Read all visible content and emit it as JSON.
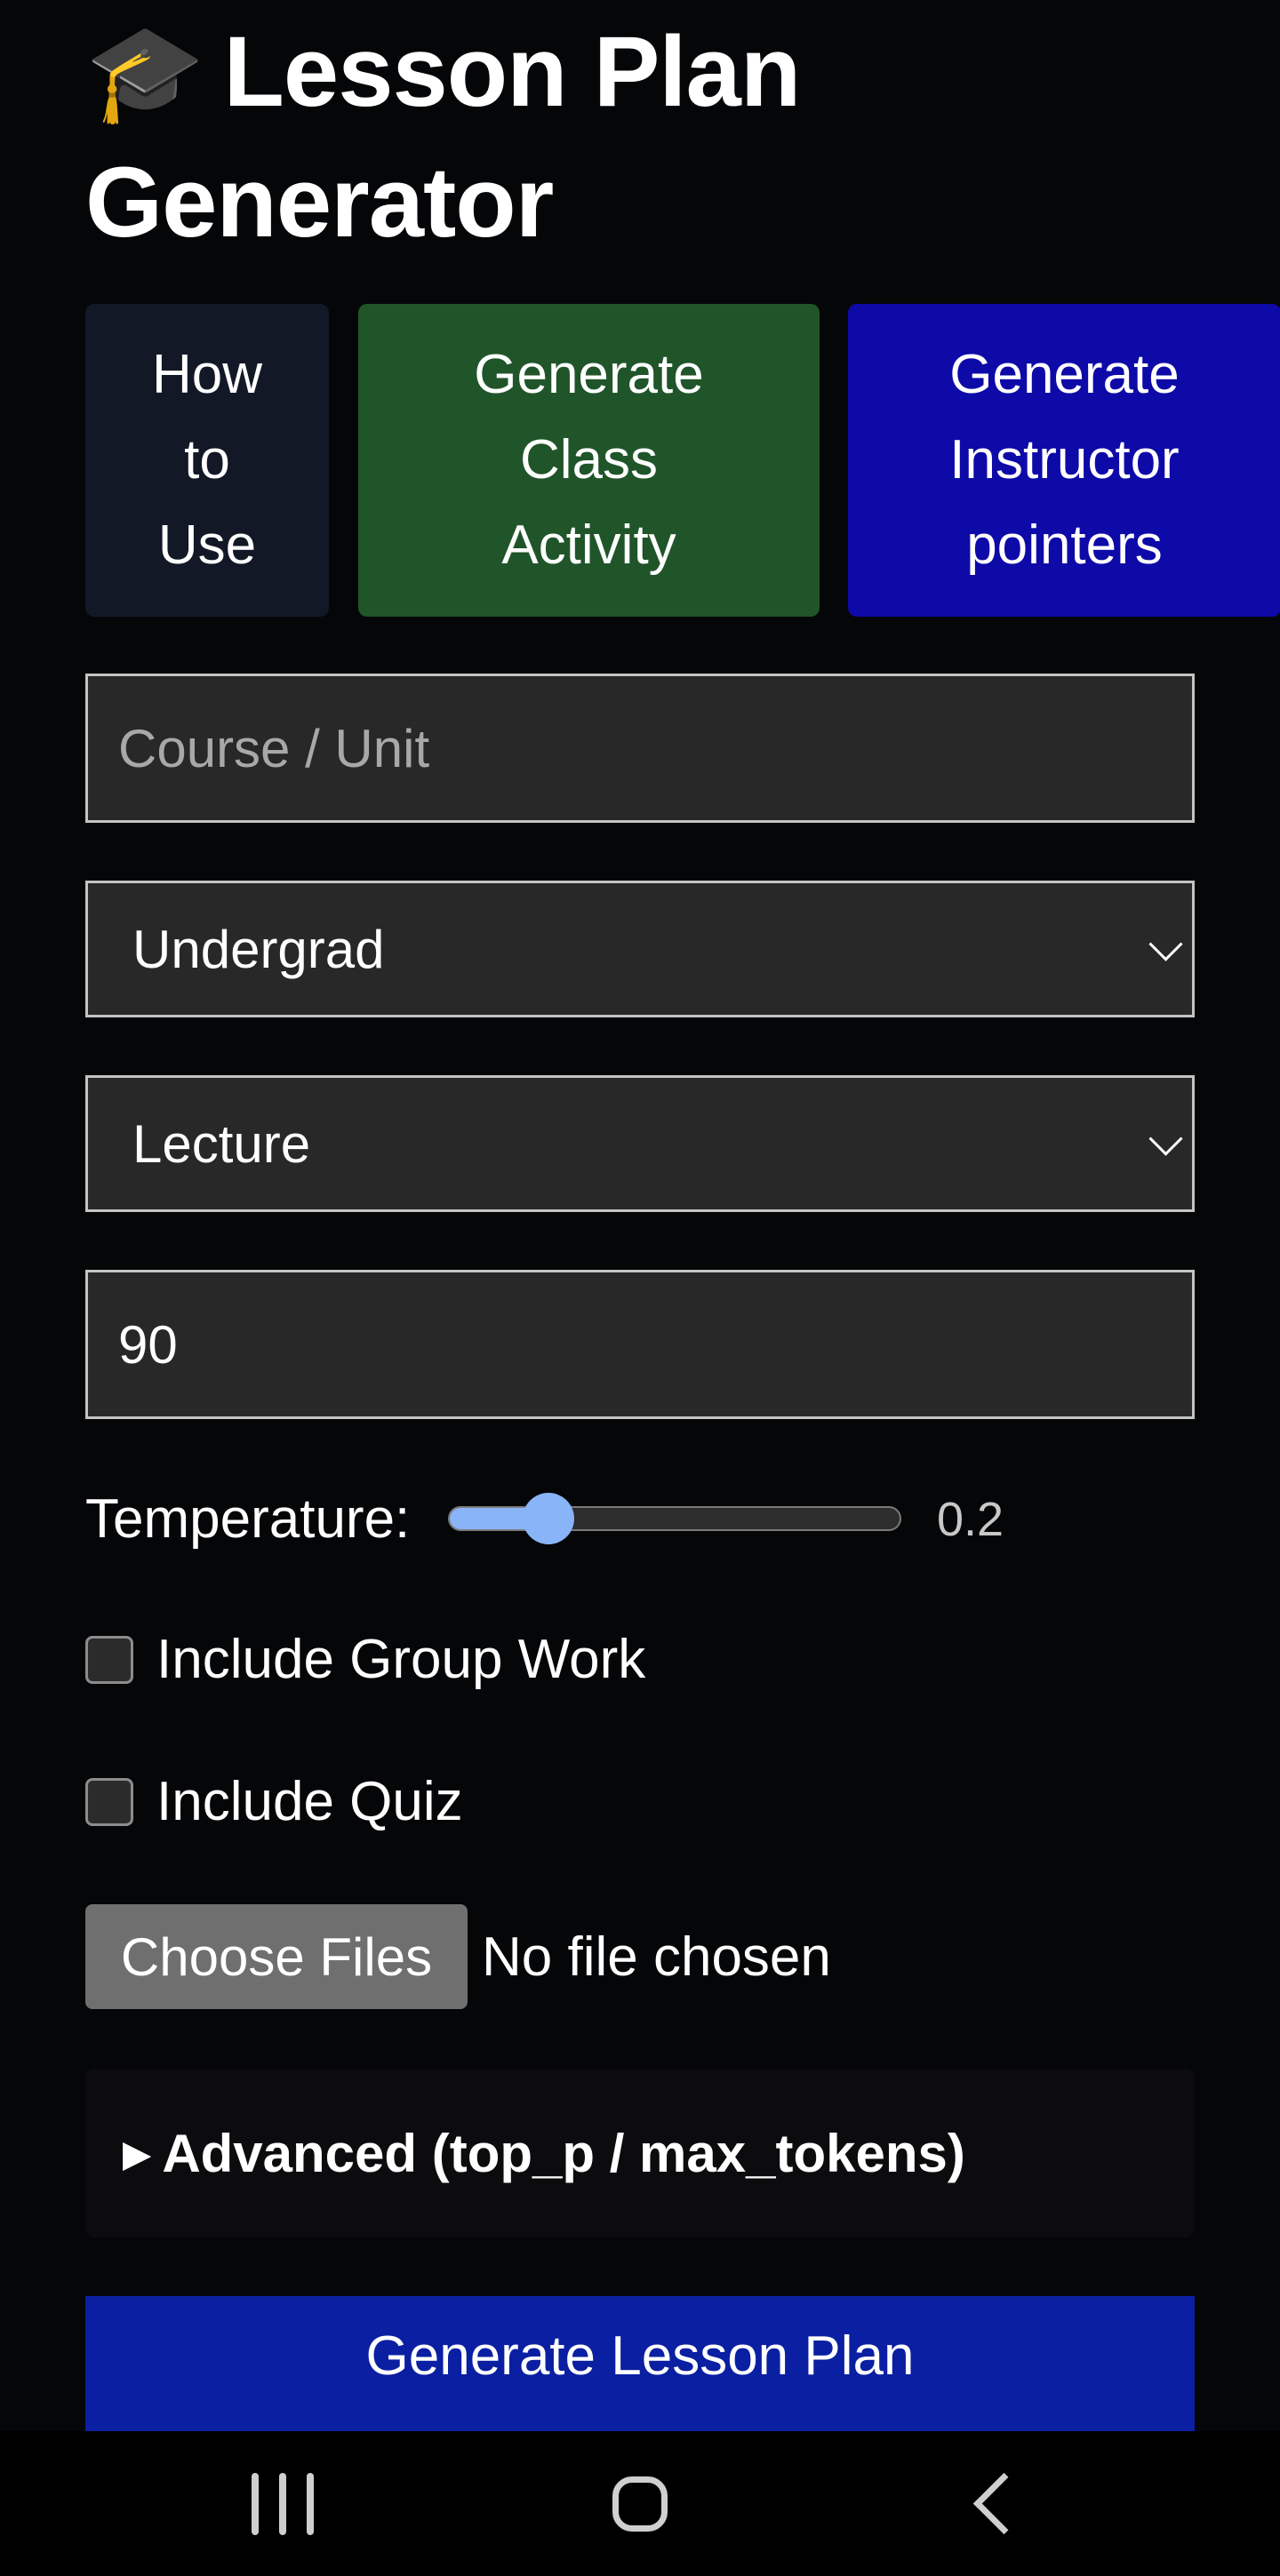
{
  "header": {
    "title_icon": "🎓",
    "title": "Lesson Plan Generator"
  },
  "top_buttons": [
    {
      "label": "How\nto\nUse",
      "color": "#121826"
    },
    {
      "label": "Generate\nClass\nActivity",
      "color": "#20552a"
    },
    {
      "label": "Generate\nInstructor\npointers",
      "color": "#0e0aa8"
    }
  ],
  "form": {
    "course_placeholder": "Course / Unit",
    "course_value": "",
    "level_selected": "Undergrad",
    "format_selected": "Lecture",
    "minutes_value": "90",
    "temperature_label": "Temperature:",
    "temperature_value": "0.2",
    "temperature_fraction": 0.2,
    "include_group_work_label": "Include Group Work",
    "include_group_work_checked": false,
    "include_quiz_label": "Include Quiz",
    "include_quiz_checked": false,
    "choose_files_label": "Choose Files",
    "file_status": "No file chosen",
    "advanced_label": "Advanced (top_p / max_tokens)",
    "generate_label": "Generate Lesson Plan"
  },
  "colors": {
    "background": "#050608",
    "field_background": "#282828",
    "accent_blue": "#0a1fa1",
    "slider_blue": "#8ab4f8"
  },
  "icons": {
    "title": "graduation-cap-icon",
    "dropdown": "chevron-down-icon",
    "details": "triangle-right-icon",
    "nav_recents": "recent-apps-icon",
    "nav_home": "home-icon",
    "nav_back": "back-icon"
  }
}
